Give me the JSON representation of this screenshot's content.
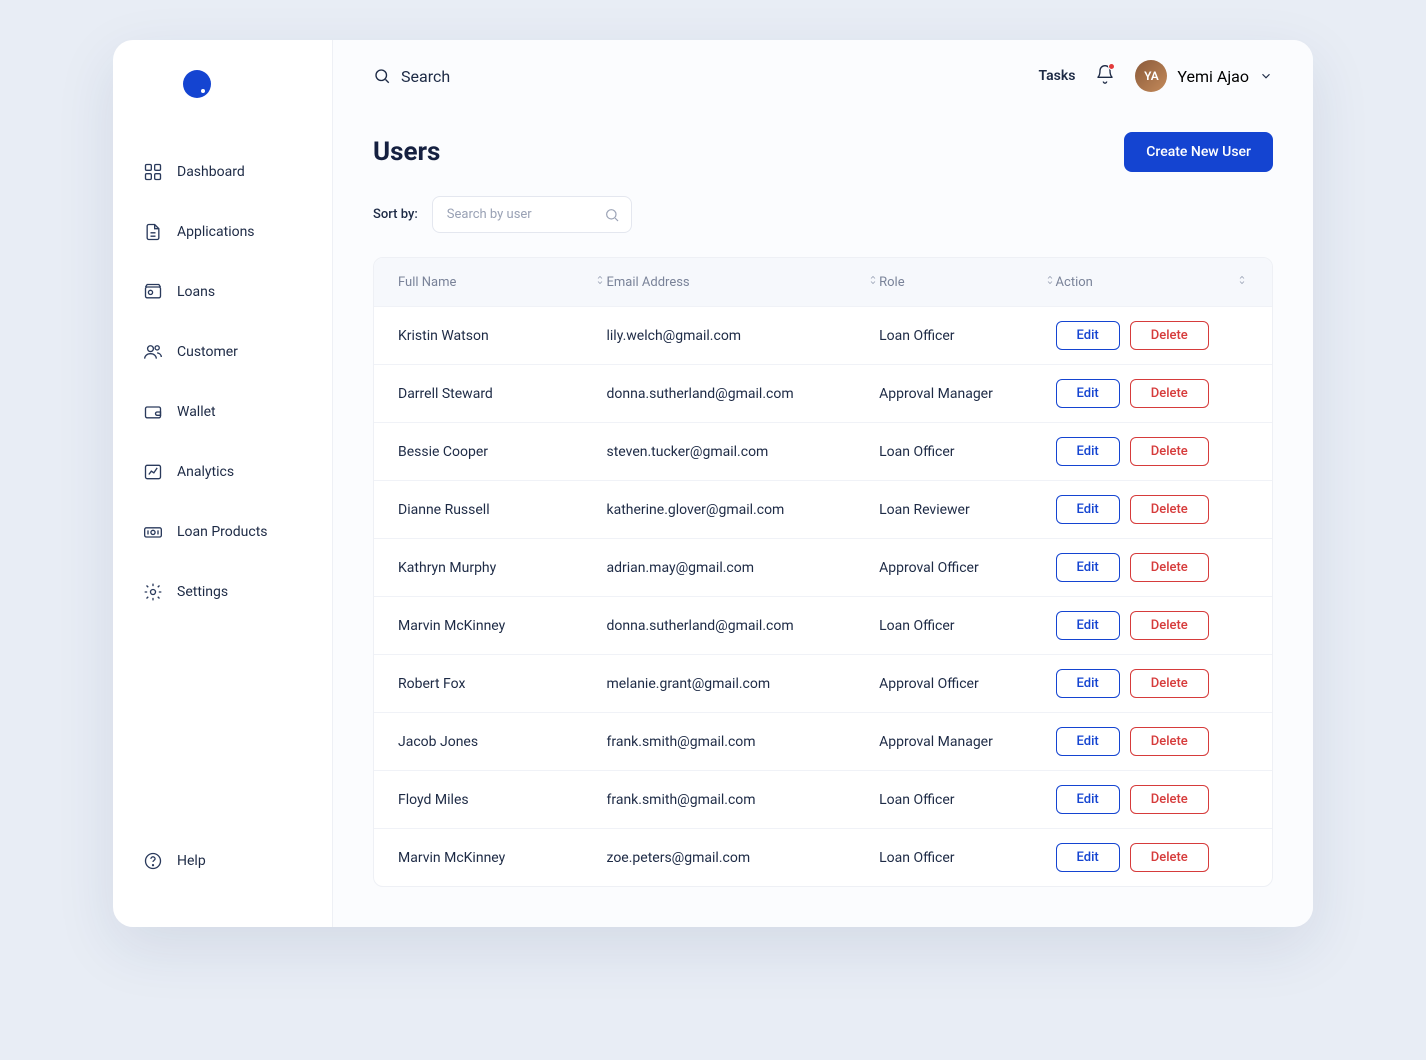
{
  "sidebar": {
    "items": [
      {
        "label": "Dashboard",
        "icon": "grid-icon"
      },
      {
        "label": "Applications",
        "icon": "file-icon"
      },
      {
        "label": "Loans",
        "icon": "safe-icon"
      },
      {
        "label": "Customer",
        "icon": "users-icon"
      },
      {
        "label": "Wallet",
        "icon": "wallet-icon"
      },
      {
        "label": "Analytics",
        "icon": "chart-icon"
      },
      {
        "label": "Loan Products",
        "icon": "money-icon"
      },
      {
        "label": "Settings",
        "icon": "gear-icon"
      }
    ],
    "bottom": {
      "label": "Help",
      "icon": "help-icon"
    }
  },
  "topbar": {
    "search_label": "Search",
    "tasks_label": "Tasks",
    "user_name": "Yemi Ajao"
  },
  "page": {
    "title": "Users",
    "create_button": "Create New User",
    "sort_label": "Sort by:",
    "sort_placeholder": "Search by user"
  },
  "table": {
    "columns": [
      "Full Name",
      "Email Address",
      "Role",
      "Action"
    ],
    "edit_label": "Edit",
    "delete_label": "Delete",
    "rows": [
      {
        "name": "Kristin Watson",
        "email": "lily.welch@gmail.com",
        "role": "Loan Officer"
      },
      {
        "name": "Darrell Steward",
        "email": "donna.sutherland@gmail.com",
        "role": "Approval Manager"
      },
      {
        "name": "Bessie Cooper",
        "email": "steven.tucker@gmail.com",
        "role": "Loan Officer"
      },
      {
        "name": "Dianne Russell",
        "email": "katherine.glover@gmail.com",
        "role": "Loan Reviewer"
      },
      {
        "name": "Kathryn Murphy",
        "email": "adrian.may@gmail.com",
        "role": "Approval Officer"
      },
      {
        "name": "Marvin McKinney",
        "email": "donna.sutherland@gmail.com",
        "role": "Loan Officer"
      },
      {
        "name": "Robert Fox",
        "email": "melanie.grant@gmail.com",
        "role": "Approval Officer"
      },
      {
        "name": "Jacob Jones",
        "email": "frank.smith@gmail.com",
        "role": "Approval Manager"
      },
      {
        "name": "Floyd Miles",
        "email": "frank.smith@gmail.com",
        "role": "Loan Officer"
      },
      {
        "name": "Marvin McKinney",
        "email": "zoe.peters@gmail.com",
        "role": "Loan Officer"
      }
    ]
  },
  "colors": {
    "primary": "#1444d1",
    "danger": "#d63b3b",
    "text": "#1d2a45",
    "muted": "#7a8399"
  }
}
